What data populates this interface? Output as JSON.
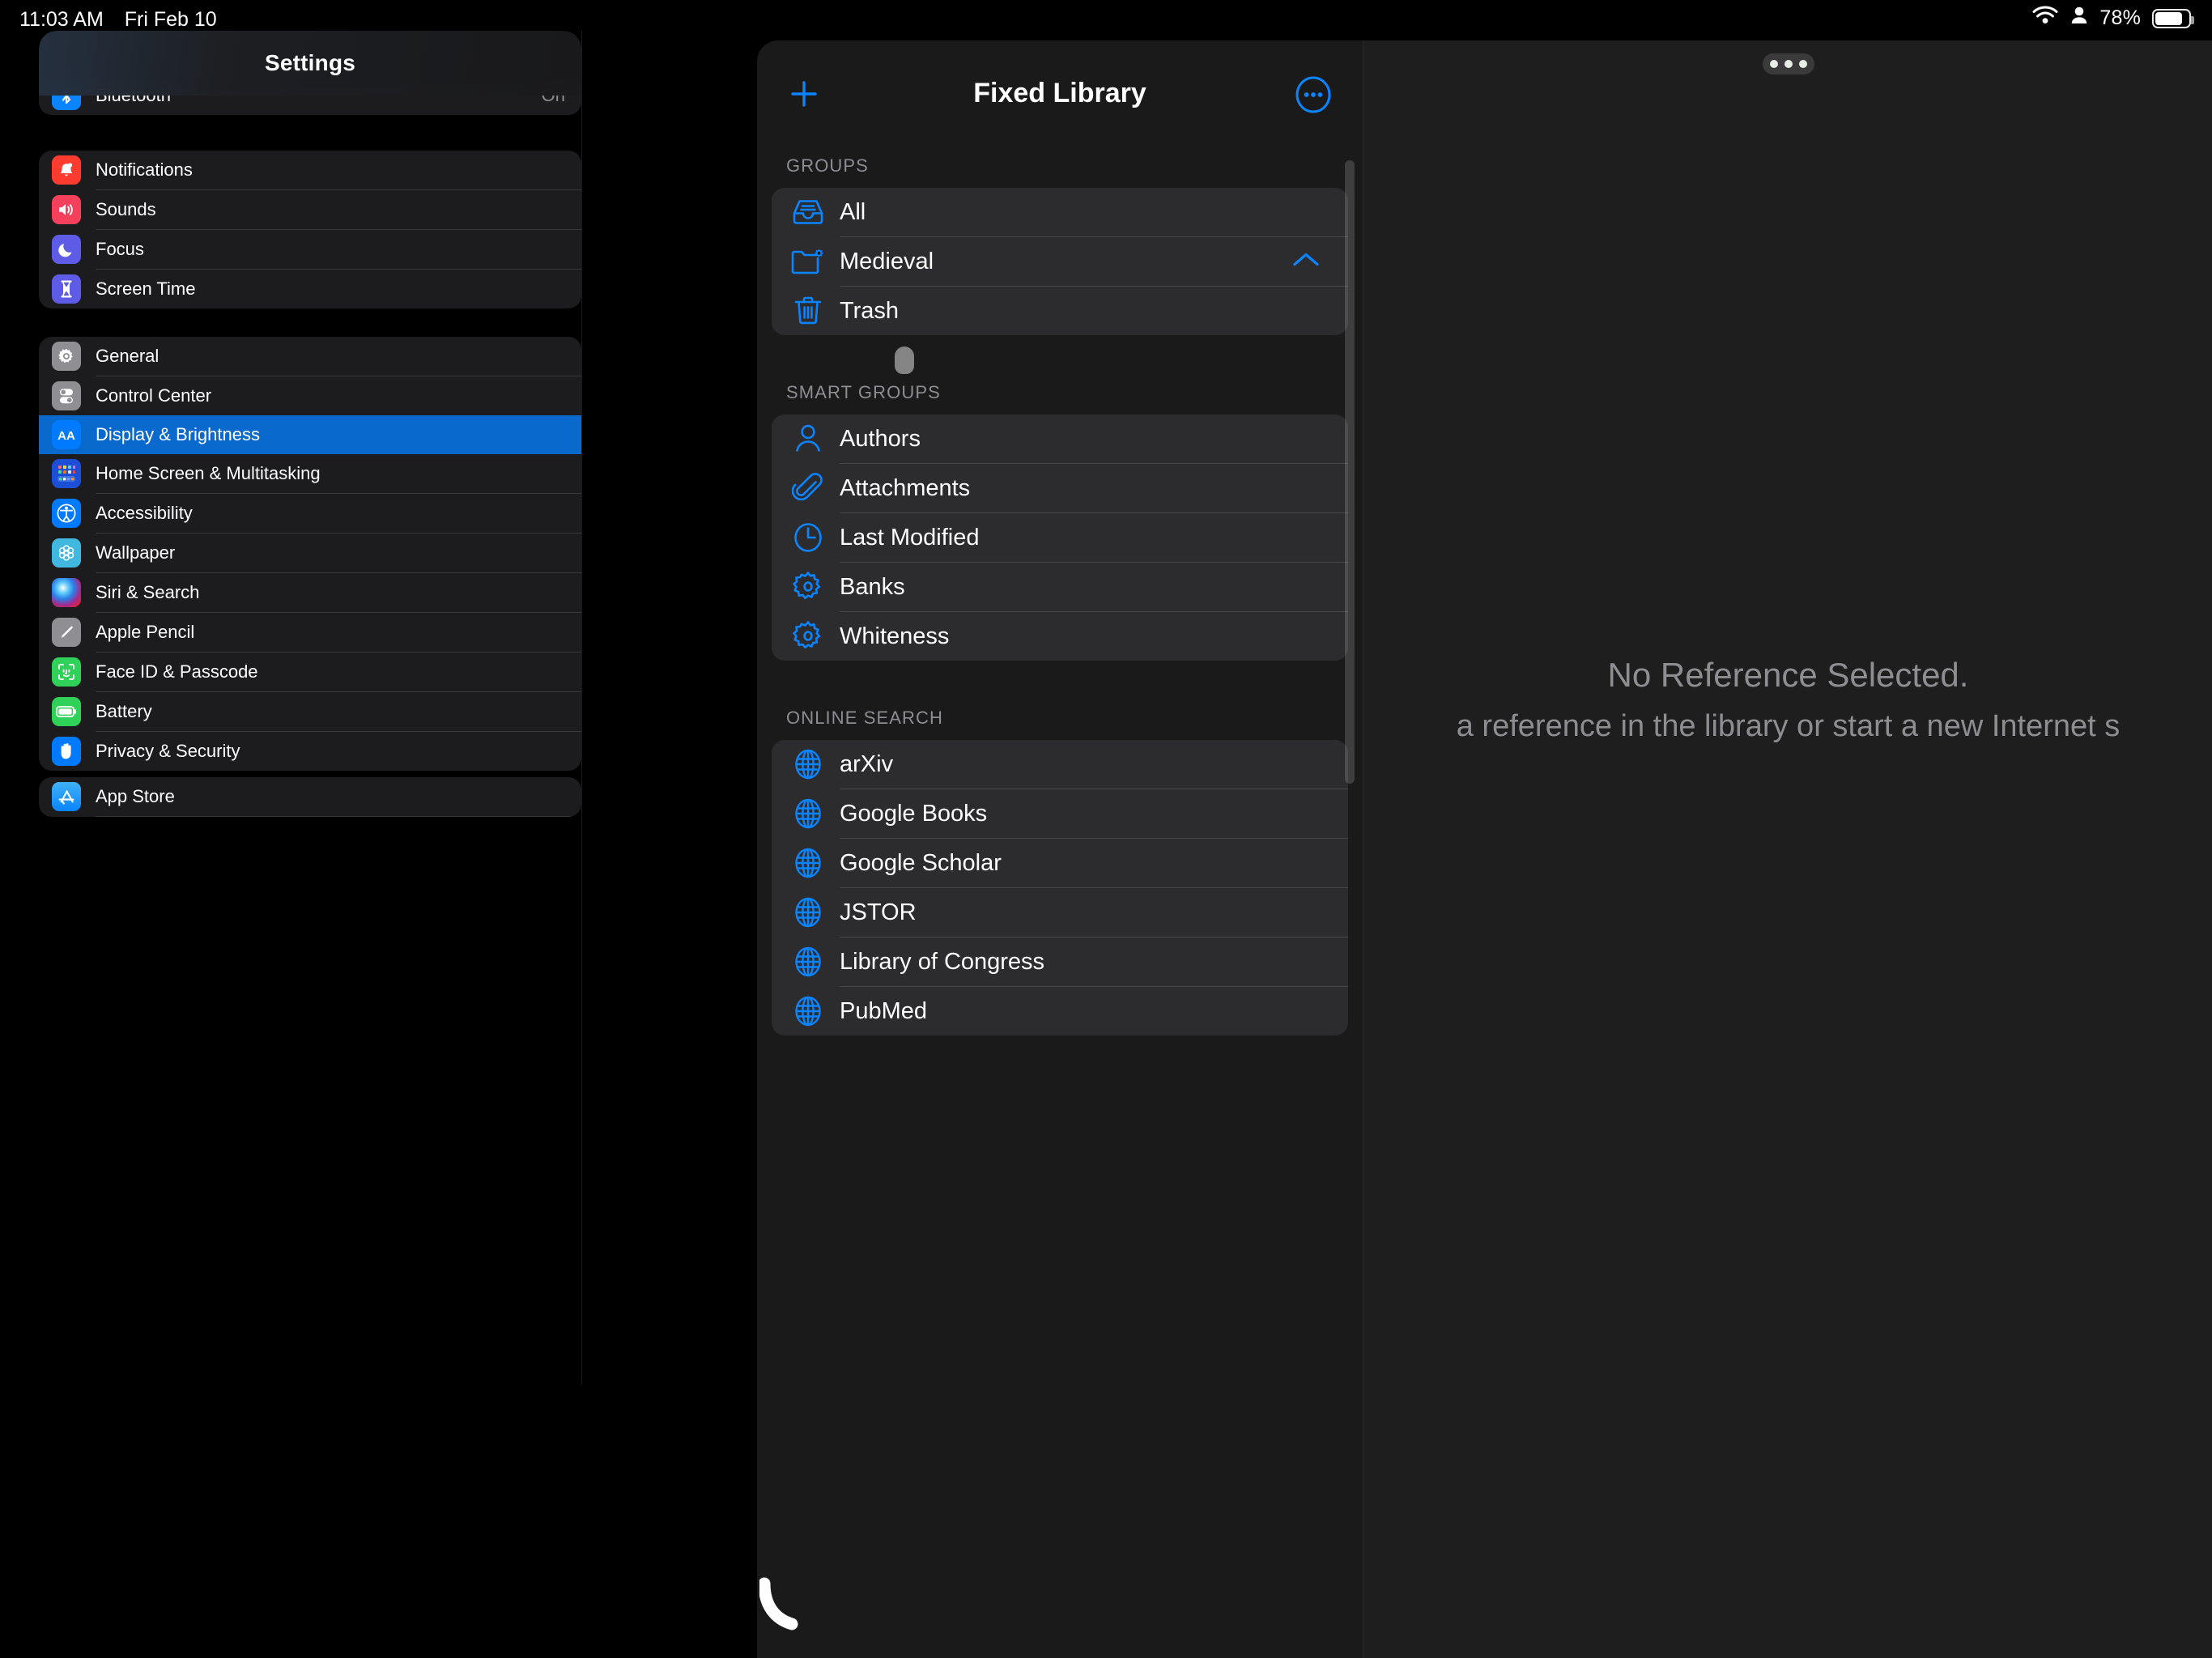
{
  "status_bar": {
    "time": "11:03 AM",
    "date": "Fri Feb 10",
    "battery_percent": "78%",
    "wifi_icon": "wifi-icon",
    "person_icon": "person-icon",
    "battery_icon": "battery-icon"
  },
  "settings": {
    "title": "Settings",
    "group_connectivity": [
      {
        "label": "Bluetooth",
        "value": "On",
        "icon": "bluetooth-icon"
      }
    ],
    "group_alerts": [
      {
        "label": "Notifications",
        "icon": "bell-icon"
      },
      {
        "label": "Sounds",
        "icon": "speaker-icon"
      },
      {
        "label": "Focus",
        "icon": "moon-icon"
      },
      {
        "label": "Screen Time",
        "icon": "hourglass-icon"
      }
    ],
    "group_system": [
      {
        "label": "General",
        "icon": "gear-icon"
      },
      {
        "label": "Control Center",
        "icon": "toggles-icon"
      },
      {
        "label": "Display & Brightness",
        "icon": "text-size-icon",
        "selected": true
      },
      {
        "label": "Home Screen & Multitasking",
        "icon": "home-grid-icon"
      },
      {
        "label": "Accessibility",
        "icon": "accessibility-icon"
      },
      {
        "label": "Wallpaper",
        "icon": "flower-icon"
      },
      {
        "label": "Siri & Search",
        "icon": "siri-icon"
      },
      {
        "label": "Apple Pencil",
        "icon": "pencil-icon"
      },
      {
        "label": "Face ID & Passcode",
        "icon": "face-id-icon"
      },
      {
        "label": "Battery",
        "icon": "battery-settings-icon"
      },
      {
        "label": "Privacy & Security",
        "icon": "hand-icon"
      }
    ],
    "group_store": [
      {
        "label": "App Store",
        "icon": "app-store-icon"
      }
    ],
    "selected_item": "Display & Brightness",
    "selected_color": "#0a69cd"
  },
  "library": {
    "title": "Fixed Library",
    "add_button": "+",
    "more_button": "more-options",
    "accent_color": "#0a84ff",
    "sections": [
      {
        "label": "GROUPS",
        "items": [
          {
            "label": "All",
            "icon": "inbox-tray-icon"
          },
          {
            "label": "Medieval",
            "icon": "folder-gear-icon",
            "accessory": "chevron-up-icon"
          },
          {
            "label": "Trash",
            "icon": "trash-icon"
          }
        ]
      },
      {
        "label": "SMART GROUPS",
        "items": [
          {
            "label": "Authors",
            "icon": "person-outline-icon"
          },
          {
            "label": "Attachments",
            "icon": "paperclip-icon"
          },
          {
            "label": "Last Modified",
            "icon": "clock-icon"
          },
          {
            "label": "Banks",
            "icon": "gear-outline-icon"
          },
          {
            "label": "Whiteness",
            "icon": "gear-outline-icon"
          }
        ]
      },
      {
        "label": "ONLINE SEARCH",
        "items": [
          {
            "label": "arXiv",
            "icon": "globe-icon"
          },
          {
            "label": "Google Books",
            "icon": "globe-icon"
          },
          {
            "label": "Google Scholar",
            "icon": "globe-icon"
          },
          {
            "label": "JSTOR",
            "icon": "globe-icon"
          },
          {
            "label": "Library of Congress",
            "icon": "globe-icon"
          },
          {
            "label": "PubMed",
            "icon": "globe-icon"
          }
        ]
      }
    ]
  },
  "detail": {
    "empty_title": "No Reference Selected.",
    "empty_subtitle": "a reference in the library or start a new Internet s",
    "multitask_handle": "multitask-handle"
  },
  "dock": {
    "phone_icon": "phone-icon"
  }
}
